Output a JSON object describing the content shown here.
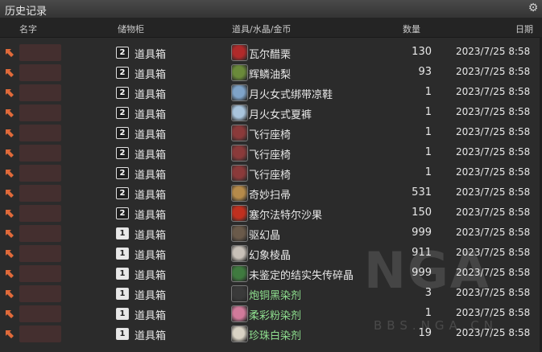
{
  "window": {
    "title": "历史记录"
  },
  "columns": {
    "name": "名字",
    "storage": "储物柜",
    "item": "道具/水晶/金币",
    "qty": "数量",
    "date": "日期"
  },
  "rows": [
    {
      "storage_num": "2",
      "storage": "道具箱",
      "item": "瓦尔醋栗",
      "qty": "130",
      "date": "2023/7/25 8:58",
      "icon_color": "#b02a2a",
      "item_green": false
    },
    {
      "storage_num": "2",
      "storage": "道具箱",
      "item": "辉鳞油梨",
      "qty": "93",
      "date": "2023/7/25 8:58",
      "icon_color": "#6a8a3a",
      "item_green": false
    },
    {
      "storage_num": "2",
      "storage": "道具箱",
      "item": "月火女式绑带凉鞋",
      "qty": "1",
      "date": "2023/7/25 8:58",
      "icon_color": "#7fa3c8",
      "item_green": false
    },
    {
      "storage_num": "2",
      "storage": "道具箱",
      "item": "月火女式夏裤",
      "qty": "1",
      "date": "2023/7/25 8:58",
      "icon_color": "#a9c4dc",
      "item_green": false
    },
    {
      "storage_num": "2",
      "storage": "道具箱",
      "item": "飞行座椅",
      "qty": "1",
      "date": "2023/7/25 8:58",
      "icon_color": "#8a3a3a",
      "item_green": false
    },
    {
      "storage_num": "2",
      "storage": "道具箱",
      "item": "飞行座椅",
      "qty": "1",
      "date": "2023/7/25 8:58",
      "icon_color": "#8a3a3a",
      "item_green": false
    },
    {
      "storage_num": "2",
      "storage": "道具箱",
      "item": "飞行座椅",
      "qty": "1",
      "date": "2023/7/25 8:58",
      "icon_color": "#8a3a3a",
      "item_green": false
    },
    {
      "storage_num": "2",
      "storage": "道具箱",
      "item": "奇妙扫帚",
      "qty": "531",
      "date": "2023/7/25 8:58",
      "icon_color": "#b58a4a",
      "item_green": false
    },
    {
      "storage_num": "2",
      "storage": "道具箱",
      "item": "塞尔法特尔沙果",
      "qty": "150",
      "date": "2023/7/25 8:58",
      "icon_color": "#c0301f",
      "item_green": false
    },
    {
      "storage_num": "1",
      "storage": "道具箱",
      "item": "驱幻晶",
      "qty": "999",
      "date": "2023/7/25 8:58",
      "icon_color": "#6a5a4a",
      "item_green": false
    },
    {
      "storage_num": "1",
      "storage": "道具箱",
      "item": "幻象棱晶",
      "qty": "911",
      "date": "2023/7/25 8:58",
      "icon_color": "#c7c0b8",
      "item_green": false
    },
    {
      "storage_num": "1",
      "storage": "道具箱",
      "item": "未鉴定的结实失传碎晶",
      "qty": "999",
      "date": "2023/7/25 8:58",
      "icon_color": "#3f7a3f",
      "item_green": false
    },
    {
      "storage_num": "1",
      "storage": "道具箱",
      "item": "炮铜黑染剂",
      "qty": "3",
      "date": "2023/7/25 8:58",
      "icon_color": "#3a3a3a",
      "item_green": true
    },
    {
      "storage_num": "1",
      "storage": "道具箱",
      "item": "柔彩粉染剂",
      "qty": "1",
      "date": "2023/7/25 8:58",
      "icon_color": "#d07a9a",
      "item_green": true
    },
    {
      "storage_num": "1",
      "storage": "道具箱",
      "item": "珍珠白染剂",
      "qty": "19",
      "date": "2023/7/25 8:58",
      "icon_color": "#d8d2c4",
      "item_green": true
    }
  ],
  "watermark": {
    "logo": "NGA",
    "text": "BBS.NGA.CN"
  },
  "colors": {
    "arrow": "#e06a3a",
    "green_text": "#8fe08f"
  }
}
